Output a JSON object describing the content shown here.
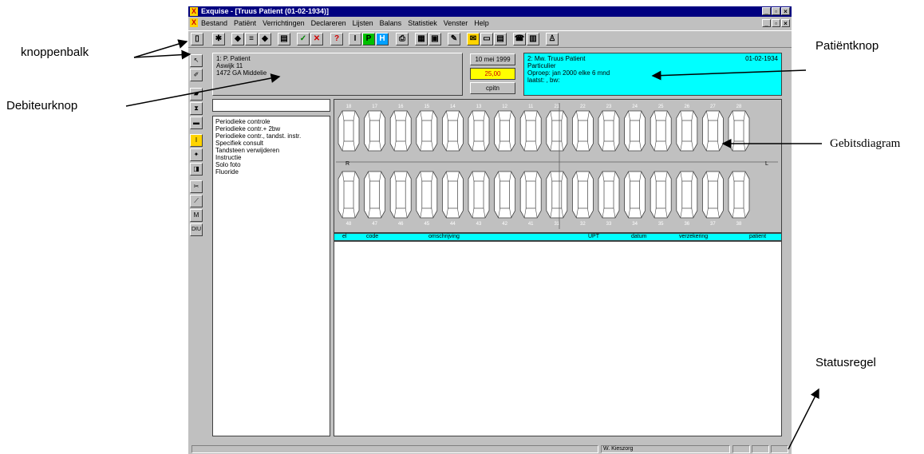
{
  "callouts": {
    "toolbar": "knoppenbalk",
    "debtor": "Debiteurknop",
    "patient": "Patiëntknop",
    "dental_chart": "Gebitsdiagram",
    "status": "Statusregel"
  },
  "window": {
    "title": "Exquise - [Truus Patient (01-02-1934)]",
    "menu": [
      "Bestand",
      "Patiënt",
      "Verrichtingen",
      "Declareren",
      "Lijsten",
      "Balans",
      "Statistiek",
      "Venster",
      "Help"
    ]
  },
  "debtor": {
    "line1": "1: P. Patient",
    "line2": "Aswijk 11",
    "line3": "1472 GA  Middelie"
  },
  "date_button": "10 mei 1999",
  "amount": "25,00",
  "cpitn_button": "cpitn",
  "patient": {
    "line1": "2: Mw. Truus Patient",
    "date": "01-02-1934",
    "line2": "Particulier",
    "line3": "Oproep: jan 2000 elke 6 mnd",
    "line4": "laatst: , bw:"
  },
  "procedures": [
    "Periodieke controle",
    "Periodieke contr.+ 2bw",
    "Periodieke contr., tandst. instr.",
    "Specifiek consult",
    "Tandsteen verwijderen",
    "Instructie",
    "Solo foto",
    "Fluoride"
  ],
  "teeth_upper": [
    "18",
    "17",
    "16",
    "15",
    "14",
    "13",
    "12",
    "11",
    "21",
    "22",
    "23",
    "24",
    "25",
    "26",
    "27",
    "28"
  ],
  "teeth_lower": [
    "48",
    "47",
    "46",
    "45",
    "44",
    "43",
    "42",
    "41",
    "31",
    "32",
    "33",
    "34",
    "35",
    "36",
    "37",
    "38"
  ],
  "chart_side_left": "R",
  "chart_side_right": "L",
  "table_headers": [
    "el",
    "code",
    "omschrijving",
    "UPT",
    "datum",
    "verzekering",
    "patient"
  ],
  "status_text": "W. Kieszorg"
}
